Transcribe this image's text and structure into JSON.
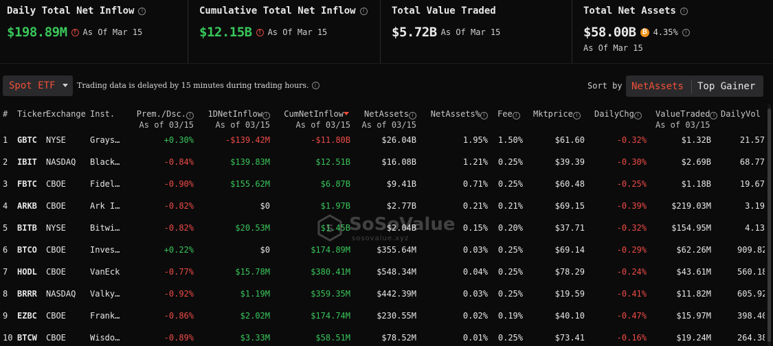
{
  "summary": {
    "daily_inflow": {
      "title": "Daily Total Net Inflow",
      "value": "$198.89M",
      "as_of": "As Of Mar 15",
      "color": "#39c659"
    },
    "cumulative_inflow": {
      "title": "Cumulative Total Net Inflow",
      "value": "$12.15B",
      "as_of": "As Of Mar 15",
      "color": "#39c659"
    },
    "value_traded": {
      "title": "Total Value Traded",
      "value": "$5.72B",
      "as_of": "As Of Mar 15"
    },
    "net_assets": {
      "title": "Total Net Assets",
      "value": "$58.00B",
      "percent": "4.35%",
      "as_of": "As Of Mar 15"
    }
  },
  "toolbar": {
    "etf_select": "Spot ETF",
    "delay_note": "Trading data is delayed by 15 minutes during trading hours.",
    "sort_label": "Sort by",
    "sort_active": "NetAssets",
    "sort_other": "Top Gainer"
  },
  "table": {
    "headers": {
      "num": "#",
      "ticker": "Ticker",
      "exchange": "Exchange",
      "inst": "Inst.",
      "prem": "Prem./Dsc.",
      "prem_sub": "As of 03/15",
      "inflow": "1DNetInflow",
      "inflow_sub": "As of 03/15",
      "cum": "CumNetInflow",
      "cum_sub": "As of 03/15",
      "assets": "NetAssets",
      "assets_sub": "As of 03/15",
      "assets_pct": "NetAssets%",
      "fee": "Fee",
      "price": "Mktprice",
      "chg": "DailyChg",
      "traded": "ValueTraded",
      "traded_sub": "As of 03/15",
      "vol": "DailyVol"
    },
    "rows": [
      {
        "num": "1",
        "ticker": "GBTC",
        "exchange": "NYSE",
        "inst": "Grays…",
        "prem": "+0.30%",
        "inflow": "-$139.42M",
        "cum": "-$11.80B",
        "assets": "$26.04B",
        "assets_pct": "1.95%",
        "fee": "1.50%",
        "price": "$61.60",
        "chg": "-0.32%",
        "traded": "$1.32B",
        "vol": "21.57"
      },
      {
        "num": "2",
        "ticker": "IBIT",
        "exchange": "NASDAQ",
        "inst": "Black…",
        "prem": "-0.84%",
        "inflow": "$139.83M",
        "cum": "$12.51B",
        "assets": "$16.08B",
        "assets_pct": "1.21%",
        "fee": "0.25%",
        "price": "$39.39",
        "chg": "-0.30%",
        "traded": "$2.69B",
        "vol": "68.77"
      },
      {
        "num": "3",
        "ticker": "FBTC",
        "exchange": "CBOE",
        "inst": "Fidel…",
        "prem": "-0.90%",
        "inflow": "$155.62M",
        "cum": "$6.87B",
        "assets": "$9.41B",
        "assets_pct": "0.71%",
        "fee": "0.25%",
        "price": "$60.48",
        "chg": "-0.25%",
        "traded": "$1.18B",
        "vol": "19.67"
      },
      {
        "num": "4",
        "ticker": "ARKB",
        "exchange": "CBOE",
        "inst": "Ark I…",
        "prem": "-0.82%",
        "inflow": "$0",
        "cum": "$1.97B",
        "assets": "$2.77B",
        "assets_pct": "0.21%",
        "fee": "0.21%",
        "price": "$69.15",
        "chg": "-0.39%",
        "traded": "$219.03M",
        "vol": "3.19"
      },
      {
        "num": "5",
        "ticker": "BITB",
        "exchange": "NYSE",
        "inst": "Bitwi…",
        "prem": "-0.82%",
        "inflow": "$20.53M",
        "cum": "$1.45B",
        "assets": "$2.04B",
        "assets_pct": "0.15%",
        "fee": "0.20%",
        "price": "$37.71",
        "chg": "-0.32%",
        "traded": "$154.95M",
        "vol": "4.13"
      },
      {
        "num": "6",
        "ticker": "BTCO",
        "exchange": "CBOE",
        "inst": "Inves…",
        "prem": "+0.22%",
        "inflow": "$0",
        "cum": "$174.89M",
        "assets": "$355.64M",
        "assets_pct": "0.03%",
        "fee": "0.25%",
        "price": "$69.14",
        "chg": "-0.29%",
        "traded": "$62.26M",
        "vol": "909.82"
      },
      {
        "num": "7",
        "ticker": "HODL",
        "exchange": "CBOE",
        "inst": "VanEck",
        "prem": "-0.77%",
        "inflow": "$15.78M",
        "cum": "$380.41M",
        "assets": "$548.34M",
        "assets_pct": "0.04%",
        "fee": "0.25%",
        "price": "$78.29",
        "chg": "-0.24%",
        "traded": "$43.61M",
        "vol": "560.18"
      },
      {
        "num": "8",
        "ticker": "BRRR",
        "exchange": "NASDAQ",
        "inst": "Valky…",
        "prem": "-0.92%",
        "inflow": "$1.19M",
        "cum": "$359.35M",
        "assets": "$442.39M",
        "assets_pct": "0.03%",
        "fee": "0.25%",
        "price": "$19.59",
        "chg": "-0.41%",
        "traded": "$11.82M",
        "vol": "605.92"
      },
      {
        "num": "9",
        "ticker": "EZBC",
        "exchange": "CBOE",
        "inst": "Frank…",
        "prem": "-0.86%",
        "inflow": "$2.02M",
        "cum": "$174.74M",
        "assets": "$230.55M",
        "assets_pct": "0.02%",
        "fee": "0.19%",
        "price": "$40.10",
        "chg": "-0.47%",
        "traded": "$15.97M",
        "vol": "398.40"
      },
      {
        "num": "10",
        "ticker": "BTCW",
        "exchange": "CBOE",
        "inst": "Wisdo…",
        "prem": "-0.89%",
        "inflow": "$3.33M",
        "cum": "$58.51M",
        "assets": "$78.52M",
        "assets_pct": "0.01%",
        "fee": "0.25%",
        "price": "$73.41",
        "chg": "-0.16%",
        "traded": "$19.24M",
        "vol": "264.38"
      }
    ]
  },
  "watermark": {
    "brand": "SoSoValue",
    "url": "sosovalue.xyz"
  },
  "colors": {
    "positive": "#39c659",
    "negative": "#ee4b45",
    "accent": "#f0503a",
    "bitcoin": "#f3921a"
  },
  "icons": [
    "info-icon",
    "warning-icon",
    "bitcoin-icon",
    "chevron-down-icon",
    "sort-desc-icon"
  ]
}
